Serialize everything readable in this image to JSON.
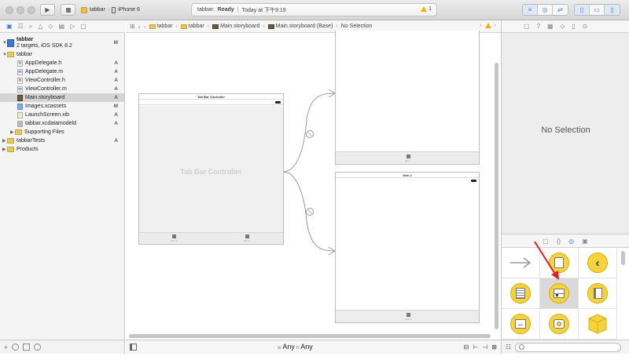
{
  "toolbar": {
    "run_icon": "play-icon",
    "stop_icon": "stop-icon",
    "scheme": "tabbar",
    "device": "iPhone 6",
    "status_project": "tabbar:",
    "status_state": "Ready",
    "status_sep": "|",
    "status_time": "Today at 下午9:19",
    "warning_count": "1",
    "accent": "#3a7bd5"
  },
  "navigator": {
    "tab_icons": [
      "folder-icon",
      "symbol-icon",
      "search-icon",
      "warning-icon",
      "test-icon",
      "debug-icon",
      "breakpoint-icon",
      "report-icon"
    ],
    "project": {
      "name": "tabbar",
      "subtitle": "2 targets, iOS SDK 8.2",
      "status": "M"
    },
    "items": [
      {
        "label": "tabbar",
        "status": "",
        "kind": "folder",
        "indent": 1,
        "open": true
      },
      {
        "label": "AppDelegate.h",
        "status": "A",
        "kind": "h",
        "indent": 2
      },
      {
        "label": "AppDelegate.m",
        "status": "A",
        "kind": "m",
        "indent": 2
      },
      {
        "label": "ViewController.h",
        "status": "A",
        "kind": "h",
        "indent": 2
      },
      {
        "label": "ViewController.m",
        "status": "A",
        "kind": "m",
        "indent": 2
      },
      {
        "label": "Main.storyboard",
        "status": "A",
        "kind": "sb",
        "indent": 2,
        "selected": true
      },
      {
        "label": "Images.xcassets",
        "status": "M",
        "kind": "assets",
        "indent": 2
      },
      {
        "label": "LaunchScreen.xib",
        "status": "A",
        "kind": "xib",
        "indent": 2
      },
      {
        "label": "tabbar.xcdatamodeld",
        "status": "A",
        "kind": "model",
        "indent": 2
      },
      {
        "label": "Supporting Files",
        "status": "",
        "kind": "folder",
        "indent": 2,
        "open": false
      },
      {
        "label": "tabbarTests",
        "status": "A",
        "kind": "folder",
        "indent": 1,
        "open": false
      },
      {
        "label": "Products",
        "status": "",
        "kind": "folder",
        "indent": 1,
        "open": false
      }
    ],
    "filter_plus": "+"
  },
  "jumpbar": {
    "crumbs": [
      "tabbar",
      "tabbar",
      "Main.storyboard",
      "Main.storyboard (Base)",
      "No Selection"
    ]
  },
  "canvas": {
    "tab_controller_title": "Tab Bar Controller",
    "tab_controller_watermark": "Tab Bar Controller",
    "tab_item_1": "Item 1",
    "tab_item_2": "Item 2",
    "scene_item1_label": "Item 1",
    "scene_item2_title": "Item 2",
    "scene_item2_label": "Item 2"
  },
  "size_class": {
    "w_prefix": "w",
    "w_value": "Any",
    "h_prefix": "h",
    "h_value": "Any"
  },
  "inspector": {
    "no_selection": "No Selection"
  },
  "library": {
    "items": [
      "arrow-icon",
      "view-controller-icon",
      "navigation-controller-icon",
      "table-view-controller-icon",
      "tab-bar-controller-icon",
      "page-view-controller-icon",
      "collection-view-controller-icon",
      "glkit-view-controller-icon",
      "object-icon"
    ],
    "arrow_color": "#e02020"
  }
}
